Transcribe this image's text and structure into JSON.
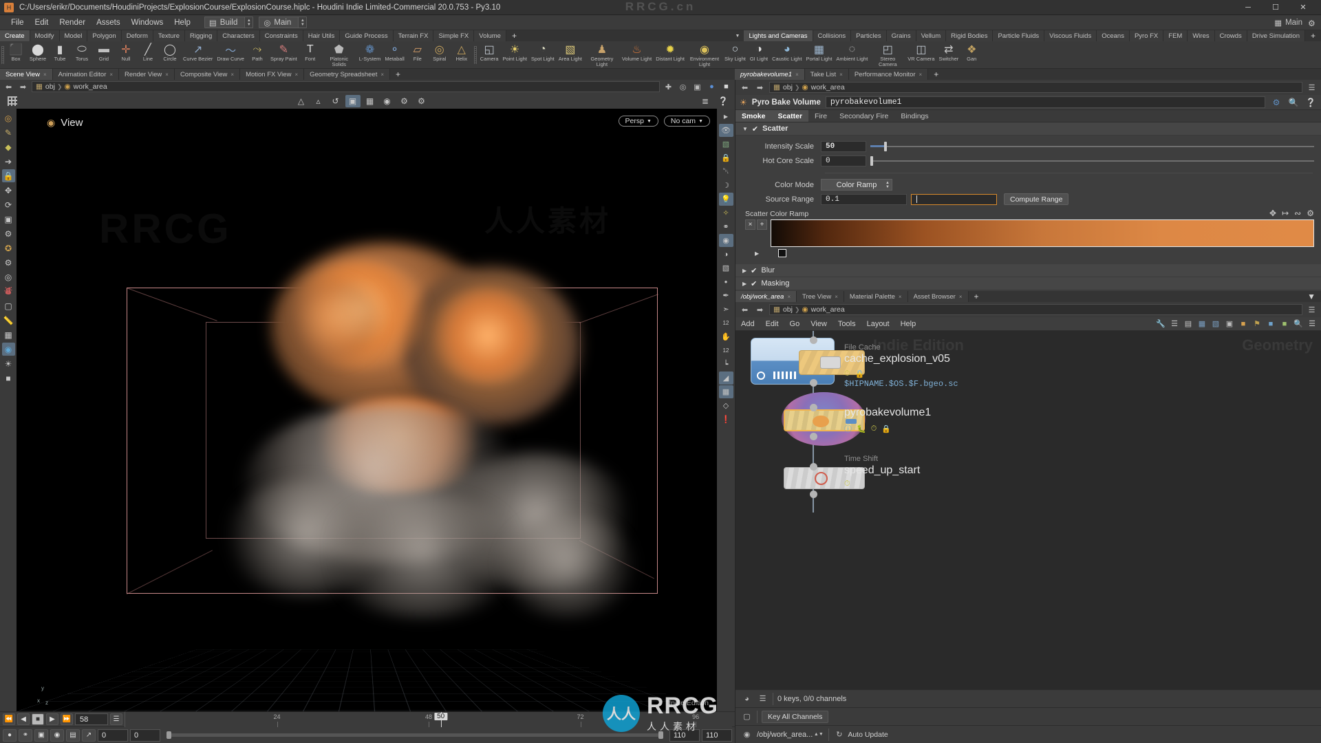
{
  "window": {
    "title": "C:/Users/erikr/Documents/HoudiniProjects/ExplosionCourse/ExplosionCourse.hiplc - Houdini Indie Limited-Commercial 20.0.753 - Py3.10",
    "app_icon": "houdini-icon",
    "minimize": "─",
    "maximize": "☐",
    "close": "✕"
  },
  "menubar": {
    "items": [
      "File",
      "Edit",
      "Render",
      "Assets",
      "Windows",
      "Help"
    ],
    "desktop_label": "Build",
    "context_label": "Main",
    "right_label": "Main"
  },
  "shelf": {
    "left_tabs": [
      "Create",
      "Modify",
      "Model",
      "Polygon",
      "Deform",
      "Texture",
      "Rigging",
      "Characters",
      "Constraints",
      "Hair Utils",
      "Guide Process",
      "Terrain FX",
      "Simple FX",
      "Volume"
    ],
    "left_active": "Create",
    "plus": "+",
    "right_tabs": [
      "Lights and Cameras",
      "Collisions",
      "Particles",
      "Grains",
      "Vellum",
      "Rigid Bodies",
      "Particle Fluids",
      "Viscous Fluids",
      "Oceans",
      "Pyro FX",
      "FEM",
      "Wires",
      "Crowds",
      "Drive Simulation"
    ],
    "right_active": "Lights and Cameras",
    "right_plus": "+",
    "left_tools": [
      {
        "label": "Box",
        "icon": "box-icon"
      },
      {
        "label": "Sphere",
        "icon": "sphere-icon"
      },
      {
        "label": "Tube",
        "icon": "tube-icon"
      },
      {
        "label": "Torus",
        "icon": "torus-icon"
      },
      {
        "label": "Grid",
        "icon": "grid-icon"
      },
      {
        "label": "Null",
        "icon": "null-icon"
      },
      {
        "label": "Line",
        "icon": "line-icon"
      },
      {
        "label": "Circle",
        "icon": "circle-icon"
      },
      {
        "label": "Curve Bezier",
        "icon": "curve-bezier-icon"
      },
      {
        "label": "Draw Curve",
        "icon": "draw-curve-icon"
      },
      {
        "label": "Path",
        "icon": "path-icon"
      },
      {
        "label": "Spray Paint",
        "icon": "spray-paint-icon"
      },
      {
        "label": "Font",
        "icon": "font-icon"
      },
      {
        "label": "Platonic Solids",
        "icon": "platonic-solids-icon"
      },
      {
        "label": "L-System",
        "icon": "l-system-icon"
      },
      {
        "label": "Metaball",
        "icon": "metaball-icon"
      },
      {
        "label": "File",
        "icon": "file-icon"
      },
      {
        "label": "Spiral",
        "icon": "spiral-icon"
      },
      {
        "label": "Helix",
        "icon": "helix-icon"
      }
    ],
    "right_tools": [
      {
        "label": "Camera",
        "icon": "camera-icon"
      },
      {
        "label": "Point Light",
        "icon": "point-light-icon"
      },
      {
        "label": "Spot Light",
        "icon": "spot-light-icon"
      },
      {
        "label": "Area Light",
        "icon": "area-light-icon"
      },
      {
        "label": "Geometry Light",
        "icon": "geometry-light-icon"
      },
      {
        "label": "Volume Light",
        "icon": "volume-light-icon"
      },
      {
        "label": "Distant Light",
        "icon": "distant-light-icon"
      },
      {
        "label": "Environment Light",
        "icon": "environment-light-icon"
      },
      {
        "label": "Sky Light",
        "icon": "sky-light-icon"
      },
      {
        "label": "GI Light",
        "icon": "gi-light-icon"
      },
      {
        "label": "Caustic Light",
        "icon": "caustic-light-icon"
      },
      {
        "label": "Portal Light",
        "icon": "portal-light-icon"
      },
      {
        "label": "Ambient Light",
        "icon": "ambient-light-icon"
      },
      {
        "label": "Stereo Camera",
        "icon": "stereo-camera-icon"
      },
      {
        "label": "VR Camera",
        "icon": "vr-camera-icon"
      },
      {
        "label": "Switcher",
        "icon": "switcher-icon"
      },
      {
        "label": "Gan",
        "icon": "gang-icon"
      }
    ]
  },
  "pane_tabs": {
    "items": [
      "Scene View",
      "Animation Editor",
      "Render View",
      "Composite View",
      "Motion FX View",
      "Geometry Spreadsheet"
    ],
    "active": "Scene View",
    "plus": "+"
  },
  "viewport": {
    "path_obj": "obj",
    "path_node": "work_area",
    "view_label": "View",
    "persp": "Persp",
    "camera": "No cam",
    "indie_edition": "Indie Edition",
    "axis_x": "x",
    "axis_y": "y",
    "axis_z": "z"
  },
  "playbar": {
    "current_frame": "58",
    "playhead_frame": "50",
    "ticks": [
      "24",
      "48",
      "72",
      "96"
    ],
    "range_start": "0",
    "range_start2": "0",
    "range_end": "110",
    "range_end2": "110",
    "keys_text": "0 keys, 0/0 channels",
    "key_all_channels": "Key All Channels",
    "auto_update": "Auto Update",
    "status_path": "/obj/work_area..."
  },
  "params": {
    "tabs": [
      {
        "label": "pyrobakevolume1",
        "italic": true,
        "closable": true
      },
      {
        "label": "Take List",
        "closable": true
      },
      {
        "label": "Performance Monitor",
        "closable": true
      }
    ],
    "active_tab": "pyrobakevolume1",
    "plus": "+",
    "path_obj": "obj",
    "path_node": "work_area",
    "node_type": "Pyro Bake Volume",
    "node_name": "pyrobakevolume1",
    "header_icons": [
      "gear-icon",
      "search-icon",
      "help-icon"
    ],
    "param_tabs": [
      "Smoke",
      "Scatter",
      "Fire",
      "Secondary Fire",
      "Bindings"
    ],
    "param_active": "Scatter",
    "section_scatter": "Scatter",
    "intensity_scale_label": "Intensity Scale",
    "intensity_scale_value": "50",
    "hot_core_scale_label": "Hot Core Scale",
    "hot_core_scale_value": "0",
    "color_mode_label": "Color Mode",
    "color_mode_value": "Color Ramp",
    "source_range_label": "Source Range",
    "source_range_value1": "0.1",
    "source_range_value2": "",
    "compute_range_label": "Compute Range",
    "scatter_ramp_label": "Scatter Color Ramp",
    "ramp_remove": "×",
    "ramp_add": "+",
    "ramp_colors": [
      "#120b06",
      "#8a4a20",
      "#d2813e",
      "#e08a46",
      "#df8945"
    ],
    "section_blur": "Blur",
    "section_masking": "Masking"
  },
  "network": {
    "tabs": [
      {
        "label": "/obj/work_area",
        "italic": true,
        "closable": true
      },
      {
        "label": "Tree View",
        "closable": true
      },
      {
        "label": "Material Palette",
        "closable": true
      },
      {
        "label": "Asset Browser",
        "closable": true
      }
    ],
    "active_tab": "/obj/work_area",
    "plus": "+",
    "path_obj": "obj",
    "path_node": "work_area",
    "menu": [
      "Add",
      "Edit",
      "Go",
      "View",
      "Tools",
      "Layout",
      "Help"
    ],
    "watermark_indie": "Indie Edition",
    "watermark_geo": "Geometry",
    "nodes": [
      {
        "type_label": "File Cache",
        "name": "cache_explosion_v05",
        "sub": "$HIPNAME.$OS.$F.bgeo.sc",
        "color": "#efc77a",
        "flags": [
          "clock-icon",
          "lock-icon"
        ]
      },
      {
        "type_label": "",
        "name": "pyrobakevolume1",
        "sub": "",
        "color": "#e7c98c",
        "flags": [
          "info-icon",
          "bug-icon",
          "clock-icon",
          "lock-icon"
        ]
      },
      {
        "type_label": "Time Shift",
        "name": "speed_up_start",
        "sub": "",
        "color": "#d8d8d8",
        "flags": [
          "clock-icon"
        ]
      }
    ]
  },
  "colors": {
    "accent_orange": "#d98a2b",
    "selection_blue": "#5b6e80",
    "panel_bg": "#3e3e3e",
    "toolbar_bg": "#3a3a3a",
    "ramp_hot": "#e08a46"
  },
  "watermark": {
    "site": "RRCG.cn",
    "brand": "RRCG",
    "sub": "人人素材",
    "logo": "人人"
  }
}
